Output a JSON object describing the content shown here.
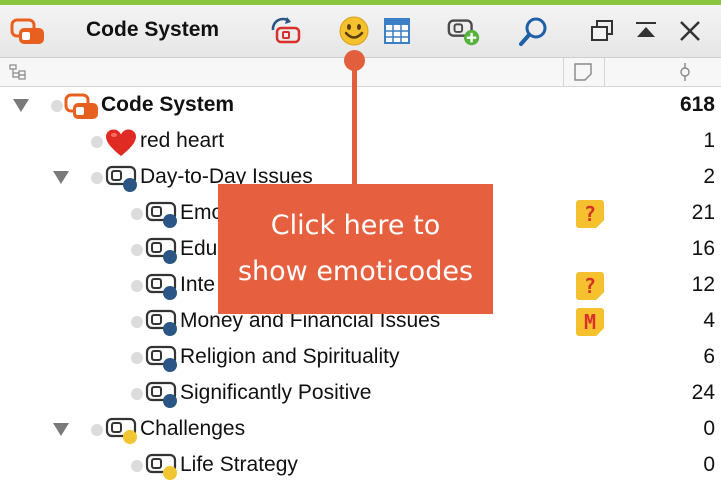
{
  "toolbar": {
    "title": "Code System",
    "icons": [
      "code-system-icon",
      "undo-code-icon",
      "emoticode-icon",
      "grid-icon",
      "new-code-icon",
      "search-icon",
      "undock-icon",
      "collapse-up-icon",
      "close-icon"
    ]
  },
  "colors": {
    "accent_green": "#8cc63f",
    "callout": "#e6603f",
    "code_blue": "#2a5585",
    "code_yellow": "#f2c532",
    "memo_yellow": "#f6c12e",
    "memo_red": "#d8302a",
    "root_orange": "#e8601f"
  },
  "tree": {
    "root": {
      "label": "Code System",
      "count": "618"
    },
    "rows": [
      {
        "label": "red heart",
        "count": "1"
      },
      {
        "label": "Day-to-Day Issues",
        "count": "2"
      },
      {
        "label": "Emo",
        "count": "21",
        "memo": "?"
      },
      {
        "label": "Edu",
        "count": "16"
      },
      {
        "label": "Inte",
        "count": "12",
        "memo": "?"
      },
      {
        "label": "Money and Financial Issues",
        "count": "4",
        "memo": "M"
      },
      {
        "label": "Religion and Spirituality",
        "count": "6"
      },
      {
        "label": "Significantly Positive",
        "count": "24"
      },
      {
        "label": "Challenges",
        "count": "0"
      },
      {
        "label": "Life Strategy",
        "count": "0"
      }
    ]
  },
  "callout": {
    "line1": "Click here to",
    "line2": "show emoticodes"
  }
}
